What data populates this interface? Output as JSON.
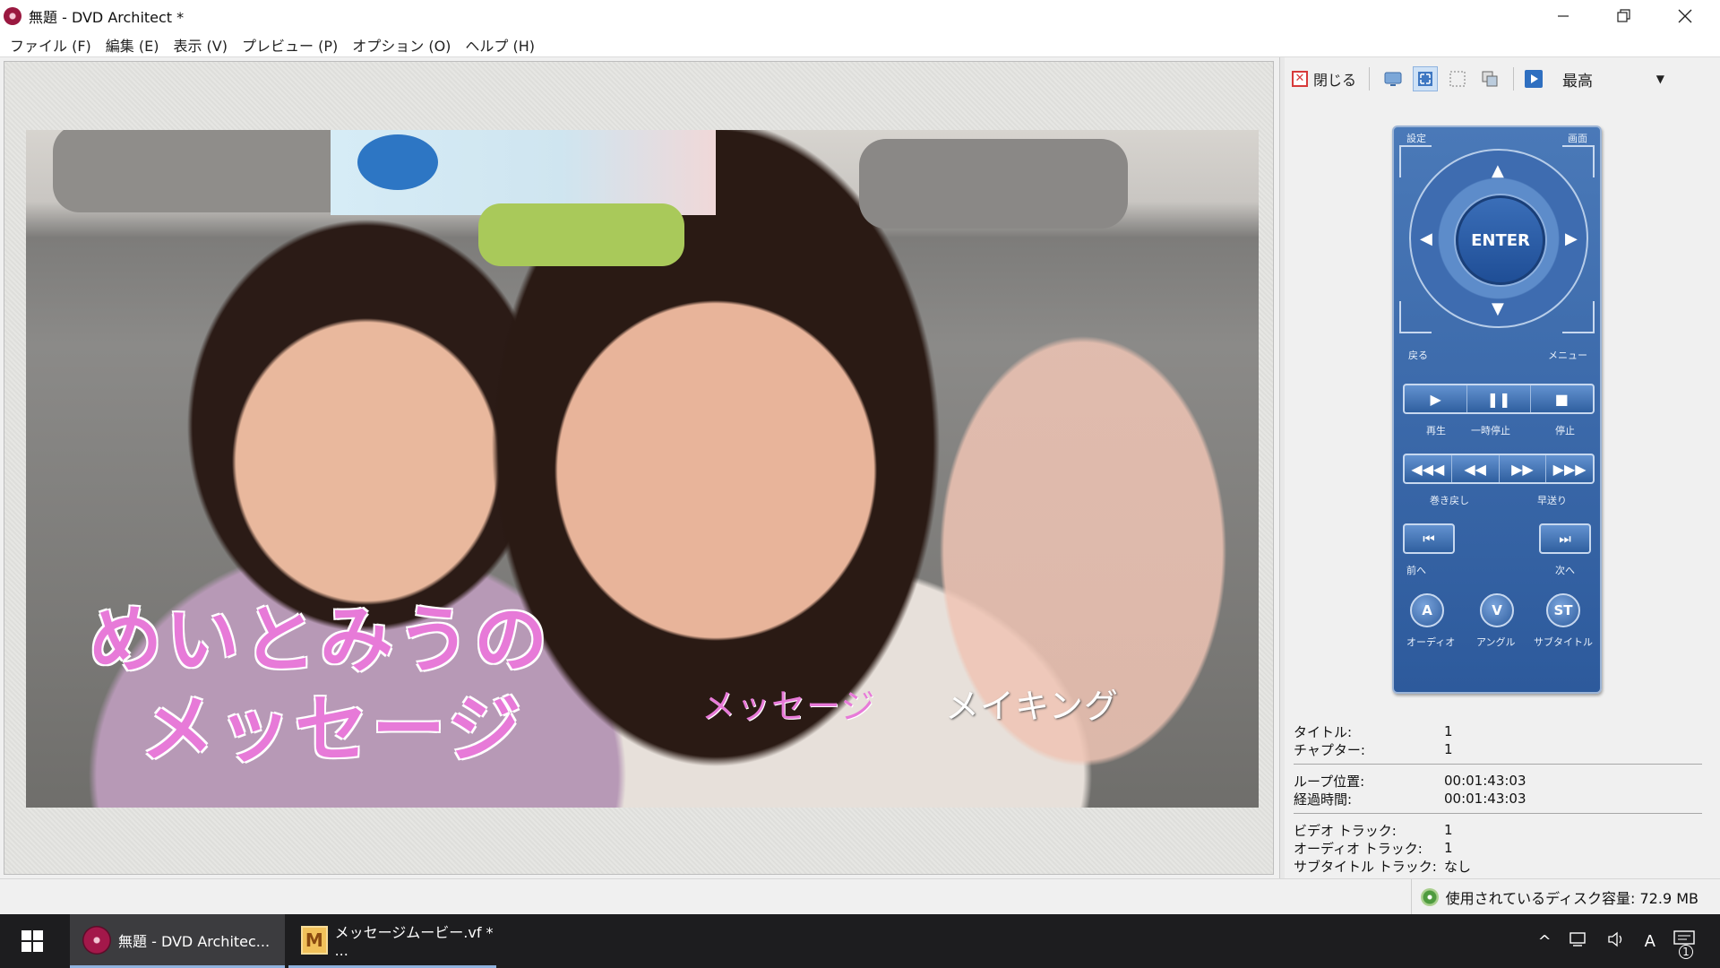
{
  "window": {
    "title": "無題 - DVD Architect *",
    "minimize_icon": "minimize-icon",
    "maximize_icon": "restore-icon",
    "close_icon": "close-icon"
  },
  "menu": {
    "items": [
      "ファイル (F)",
      "編集 (E)",
      "表示 (V)",
      "プレビュー (P)",
      "オプション (O)",
      "ヘルプ (H)"
    ]
  },
  "preview": {
    "title_line1": "めいとみうの",
    "title_line2": "メッセージ",
    "button1": "メッセージ",
    "button2": "メイキング"
  },
  "toolbar": {
    "close_label": "閉じる",
    "quality": "最高"
  },
  "remote": {
    "settings": "設定",
    "screen": "画面",
    "enter": "ENTER",
    "back": "戻る",
    "menu": "メニュー",
    "play": "再生",
    "pause": "一時停止",
    "stop": "停止",
    "rewind": "巻き戻し",
    "fastforward": "早送り",
    "prev": "前へ",
    "next": "次へ",
    "audio_btn": "A",
    "angle_btn": "V",
    "subtitle_btn": "ST",
    "audio": "オーディオ",
    "angle": "アングル",
    "subtitle": "サブタイトル"
  },
  "info": {
    "title_k": "タイトル:",
    "title_v": "1",
    "chapter_k": "チャプター:",
    "chapter_v": "1",
    "loop_k": "ループ位置:",
    "loop_v": "00:01:43:03",
    "elapsed_k": "経過時間:",
    "elapsed_v": "00:01:43:03",
    "video_k": "ビデオ トラック:",
    "video_v": "1",
    "audio_k": "オーディオ トラック:",
    "audio_v": "1",
    "sub_k": "サブタイトル トラック:",
    "sub_v": "なし"
  },
  "status": {
    "disk": "使用されているディスク容量: 72.9 MB"
  },
  "taskbar": {
    "app1": "無題 - DVD Architec...",
    "app2": "メッセージムービー.vf * ...",
    "ime": "A",
    "notifications": "1"
  }
}
